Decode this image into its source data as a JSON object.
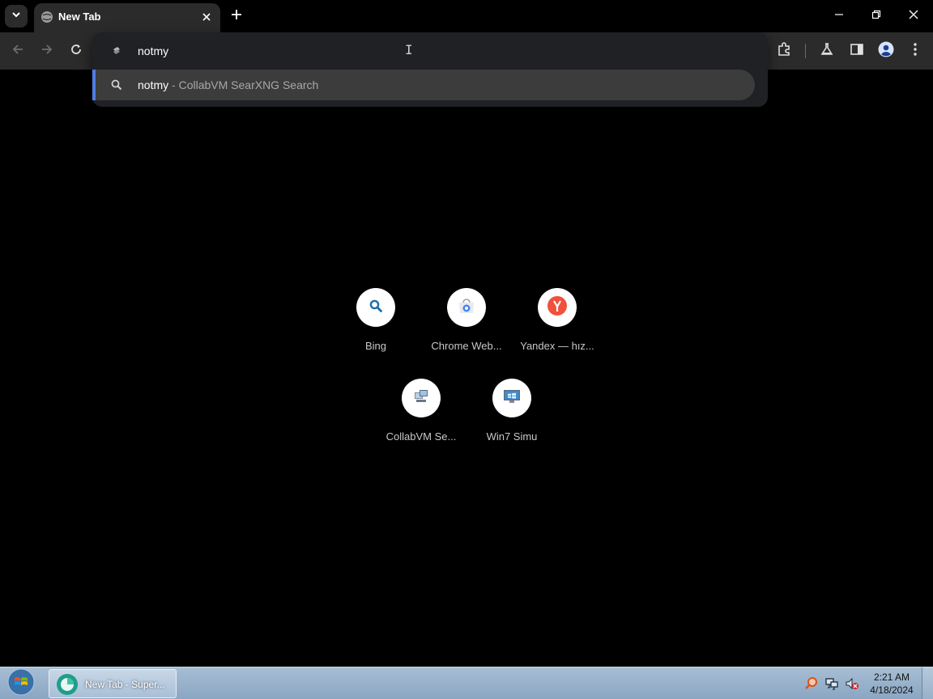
{
  "tab": {
    "title": "New Tab"
  },
  "omnibox": {
    "value": "notmy"
  },
  "suggestion": {
    "query": "notmy",
    "separator": " - ",
    "provider": "CollabVM SearXNG Search"
  },
  "shortcuts": [
    {
      "label": "Bing",
      "icon": "bing-search-icon"
    },
    {
      "label": "Chrome Web...",
      "icon": "chrome-web-store-icon"
    },
    {
      "label": "Yandex — hız...",
      "icon": "yandex-icon"
    },
    {
      "label": "CollabVM Se...",
      "icon": "collabvm-icon"
    },
    {
      "label": "Win7 Simu",
      "icon": "win7-simu-icon"
    }
  ],
  "taskbar": {
    "task_label": "New Tab - Super...",
    "time": "2:21 AM",
    "date": "4/18/2024"
  },
  "colors": {
    "accent": "#4f7ce8",
    "toolbar": "#2b2b2b",
    "yandex": "#f0503c"
  }
}
